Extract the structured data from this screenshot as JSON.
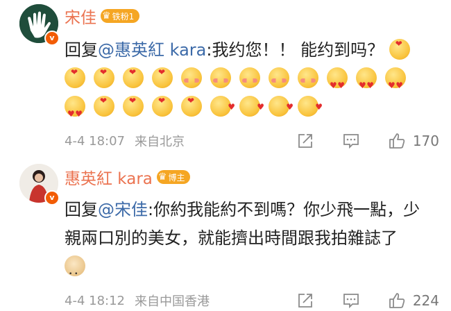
{
  "comments": [
    {
      "username": "宋佳",
      "badge_text": "铁粉1",
      "badge_color": "#f5a623",
      "reply_prefix": "回复",
      "mention": "@惠英紅 kara",
      "body": ":我约您！！ 能约到吗？",
      "emoji_icons": [
        "hug",
        "hug",
        "hug",
        "hug",
        "hug",
        "blush",
        "blush",
        "blush",
        "blush",
        "blush",
        "love",
        "love",
        "love",
        "love",
        "hug",
        "hug",
        "hug",
        "hug",
        "wink",
        "wink",
        "wink",
        "wink"
      ],
      "timestamp": "4-4 18:07",
      "location": "来自北京",
      "likes": "170"
    },
    {
      "username": "惠英紅 kara",
      "badge_text": "博主",
      "badge_color": "#f5a623",
      "reply_prefix": "回复",
      "mention": "@宋佳",
      "body": ":你約我能約不到嗎？你少飛一點，少親兩口別的美女，就能擠出時間跟我拍雜誌了",
      "emoji_icons": [
        "dog"
      ],
      "timestamp": "4-4 18:12",
      "location": "来自中国香港",
      "likes": "224"
    }
  ],
  "colors": {
    "username": "#eb7350",
    "mention": "#3c6aa8",
    "meta": "#999999",
    "verified": "#f25c05"
  }
}
